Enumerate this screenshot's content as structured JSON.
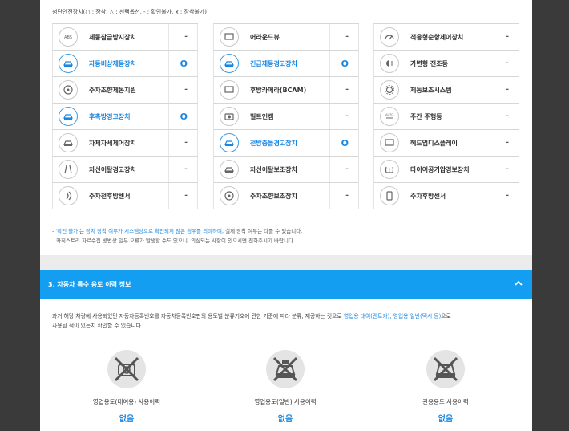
{
  "legend": "첨단안전장치(○ : 장착, △ : 선택옵션, - : 확인불가, x : 장착불가)",
  "columns": [
    [
      {
        "label": "제동잠금방지장치",
        "value": "-",
        "icon": "abs-icon",
        "glyph": "ABS",
        "highlight": false
      },
      {
        "label": "자동비상제동장치",
        "value": "O",
        "icon": "emergency-brake-icon",
        "glyph": "car",
        "highlight": true
      },
      {
        "label": "주차조향제동지원",
        "value": "-",
        "icon": "park-steer-icon",
        "glyph": "wheel",
        "highlight": false
      },
      {
        "label": "후측방경고장치",
        "value": "O",
        "icon": "rear-side-warning-icon",
        "glyph": "car",
        "highlight": true
      },
      {
        "label": "차체자세제어장치",
        "value": "-",
        "icon": "stability-control-icon",
        "glyph": "car",
        "highlight": false
      },
      {
        "label": "차선이탈경고장치",
        "value": "-",
        "icon": "lane-departure-warning-icon",
        "glyph": "lane",
        "highlight": false
      },
      {
        "label": "주차전후방센서",
        "value": "-",
        "icon": "parking-sensor-icon",
        "glyph": "wave",
        "highlight": false
      }
    ],
    [
      {
        "label": "어라운드뷰",
        "value": "-",
        "icon": "around-view-icon",
        "glyph": "screen",
        "highlight": false
      },
      {
        "label": "긴급제동경고장치",
        "value": "O",
        "icon": "emergency-brake-warning-icon",
        "glyph": "car",
        "highlight": true
      },
      {
        "label": "후방카메라(BCAM)",
        "value": "-",
        "icon": "rear-camera-icon",
        "glyph": "screen",
        "highlight": false
      },
      {
        "label": "빌트인캠",
        "value": "-",
        "icon": "builtin-cam-icon",
        "glyph": "cam",
        "highlight": false
      },
      {
        "label": "전방충돌경고장치",
        "value": "O",
        "icon": "forward-collision-icon",
        "glyph": "car",
        "highlight": true
      },
      {
        "label": "차선이탈보조장치",
        "value": "-",
        "icon": "lane-keep-assist-icon",
        "glyph": "car",
        "highlight": false
      },
      {
        "label": "주차조향보조장치",
        "value": "-",
        "icon": "park-assist-icon",
        "glyph": "wheel",
        "highlight": false
      }
    ],
    [
      {
        "label": "적응형순항제어장치",
        "value": "-",
        "icon": "adaptive-cruise-icon",
        "glyph": "gauge",
        "highlight": false
      },
      {
        "label": "가변형 전조등",
        "value": "-",
        "icon": "adaptive-headlight-icon",
        "glyph": "light",
        "highlight": false
      },
      {
        "label": "제동보조시스템",
        "value": "-",
        "icon": "brake-assist-icon",
        "glyph": "brake",
        "highlight": false
      },
      {
        "label": "주간 주행등",
        "value": "-",
        "icon": "daytime-light-icon",
        "glyph": "AUTO",
        "highlight": false
      },
      {
        "label": "헤드업디스플레이",
        "value": "-",
        "icon": "hud-icon",
        "glyph": "screen",
        "highlight": false
      },
      {
        "label": "타이어공기압경보장치",
        "value": "-",
        "icon": "tpms-icon",
        "glyph": "tire",
        "highlight": false
      },
      {
        "label": "주차후방센서",
        "value": "-",
        "icon": "rear-parking-sensor-icon",
        "glyph": "phone",
        "highlight": false
      }
    ]
  ],
  "notes": {
    "line1_prefix": "- '",
    "line1_highlight": "확인 불가",
    "line1_mid": "'는 ",
    "line1_blue": "장치 장착 여부가 시스템상으로 확인되지 않은 경우를 의미하며,",
    "line1_suffix": " 실제 장착 여부는 다를 수 있습니다.",
    "line2": "카히스토리 자료수집 방법상 일부 오류가 발생할 수도 있으니, 의심되는 사항이 있으시면 전화주시기 바랍니다."
  },
  "section": {
    "title": "3. 자동차 특수 용도 이력 정보"
  },
  "description": {
    "before": "과거 해당 차량에 사용되었던 자동차등록번호를 자동차등록번호판의 용도별 분류기호에 관한 기준에 따라 분류, 제공하는 것으로 ",
    "highlight": "영업용 대여(렌트카), 영업용 일반(택시 등)",
    "after": "으로",
    "line2": "사용된 적이 있는지 확인할 수 있습니다."
  },
  "history": [
    {
      "label": "영업용도(대여용) 사용이력",
      "result": "없음",
      "icon": "rental-car-icon"
    },
    {
      "label": "영업용도(일반) 사용이력",
      "result": "없음",
      "icon": "taxi-icon"
    },
    {
      "label": "관용용도 사용이력",
      "result": "없음",
      "icon": "government-car-icon"
    }
  ]
}
